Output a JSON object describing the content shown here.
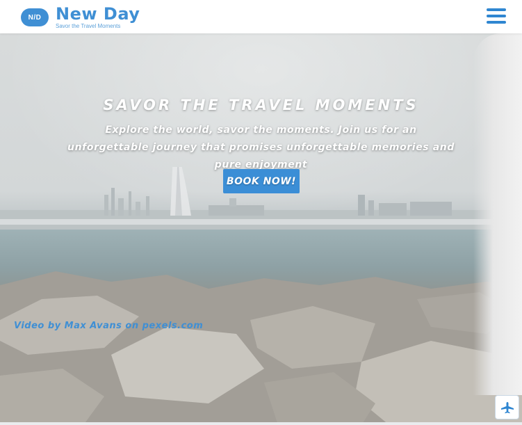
{
  "brand": {
    "badge": "N/D",
    "name": "New Day",
    "tagline": "Savor the Travel Moments",
    "color": "#3f8fd4"
  },
  "header": {
    "menu_icon": "hamburger-menu-icon"
  },
  "hero": {
    "title": "SAVOR THE TRAVEL MOMENTS",
    "subtitle": "Explore the world, savor the moments. Join us for an unforgettable journey that promises unforgettable memories and pure enjoyment",
    "cta_label": "BOOK NOW!",
    "credit": "Video by Max Avans on pexels.com"
  },
  "floating": {
    "icon": "airplane-icon"
  }
}
